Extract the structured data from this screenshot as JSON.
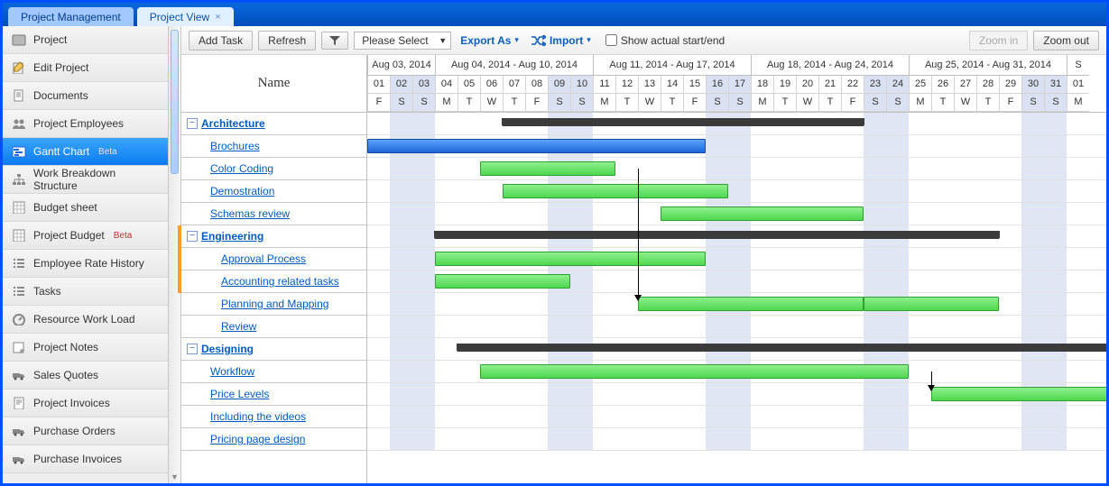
{
  "tabs": {
    "items": [
      "Project Management",
      "Project View"
    ],
    "active": 1
  },
  "sidebar": {
    "items": [
      {
        "label": "Project",
        "icon": "box"
      },
      {
        "label": "Edit Project",
        "icon": "edit"
      },
      {
        "label": "Documents",
        "icon": "doc"
      },
      {
        "label": "Project Employees",
        "icon": "people"
      },
      {
        "label": "Gantt Chart",
        "icon": "gantt",
        "beta": "Beta",
        "selected": true
      },
      {
        "label": "Work Breakdown Structure",
        "icon": "wbs"
      },
      {
        "label": "Budget sheet",
        "icon": "sheet"
      },
      {
        "label": "Project Budget",
        "icon": "sheet",
        "beta": "Beta"
      },
      {
        "label": "Employee Rate History",
        "icon": "list"
      },
      {
        "label": "Tasks",
        "icon": "list"
      },
      {
        "label": "Resource Work Load",
        "icon": "gauge"
      },
      {
        "label": "Project Notes",
        "icon": "note"
      },
      {
        "label": "Sales Quotes",
        "icon": "truck"
      },
      {
        "label": "Project Invoices",
        "icon": "invoice"
      },
      {
        "label": "Purchase Orders",
        "icon": "truck"
      },
      {
        "label": "Purchase Invoices",
        "icon": "truck"
      }
    ]
  },
  "toolbar": {
    "add_task": "Add Task",
    "refresh": "Refresh",
    "filter_icon": "filter-icon",
    "select_placeholder": "Please Select",
    "export": "Export As",
    "import": "Import",
    "actual": "Show actual start/end",
    "zoom_in": "Zoom in",
    "zoom_out": "Zoom out"
  },
  "grid": {
    "name_header": "Name"
  },
  "weeks": [
    {
      "label": "Aug 03, 2014",
      "days": 3
    },
    {
      "label": "Aug 04, 2014 - Aug 10, 2014",
      "days": 7
    },
    {
      "label": "Aug 11, 2014 - Aug 17, 2014",
      "days": 7
    },
    {
      "label": "Aug 18, 2014 - Aug 24, 2014",
      "days": 7
    },
    {
      "label": "Aug 25, 2014 - Aug 31, 2014",
      "days": 7
    },
    {
      "label": "S",
      "days": 1
    }
  ],
  "day_start": 1,
  "days": [
    "01",
    "02",
    "03",
    "04",
    "05",
    "06",
    "07",
    "08",
    "09",
    "10",
    "11",
    "12",
    "13",
    "14",
    "15",
    "16",
    "17",
    "18",
    "19",
    "20",
    "21",
    "22",
    "23",
    "24",
    "25",
    "26",
    "27",
    "28",
    "29",
    "30",
    "31",
    "01"
  ],
  "dow": [
    "F",
    "S",
    "S",
    "M",
    "T",
    "W",
    "T",
    "F",
    "S",
    "S",
    "M",
    "T",
    "W",
    "T",
    "F",
    "S",
    "S",
    "M",
    "T",
    "W",
    "T",
    "F",
    "S",
    "S",
    "M",
    "T",
    "W",
    "T",
    "F",
    "S",
    "S",
    "M"
  ],
  "weekend_idx": [
    1,
    2,
    8,
    9,
    15,
    16,
    22,
    23,
    29,
    30
  ],
  "rows": [
    {
      "name": "Architecture",
      "type": "group"
    },
    {
      "name": "Brochures",
      "type": "task",
      "indent": 1
    },
    {
      "name": "Color Coding",
      "type": "task",
      "indent": 1
    },
    {
      "name": "Demostration",
      "type": "task",
      "indent": 1
    },
    {
      "name": "Schemas review",
      "type": "task",
      "indent": 1
    },
    {
      "name": "Engineering",
      "type": "group"
    },
    {
      "name": "Approval Process",
      "type": "task",
      "indent": 2
    },
    {
      "name": "Accounting related tasks",
      "type": "task",
      "indent": 2
    },
    {
      "name": "Planning and Mapping",
      "type": "task",
      "indent": 2
    },
    {
      "name": "Review",
      "type": "task",
      "indent": 2
    },
    {
      "name": "Designing",
      "type": "group"
    },
    {
      "name": "Workflow",
      "type": "task",
      "indent": 1
    },
    {
      "name": "Price Levels",
      "type": "task",
      "indent": 1
    },
    {
      "name": "Including the videos",
      "type": "task",
      "indent": 1
    },
    {
      "name": "Pricing page design",
      "type": "task",
      "indent": 1
    }
  ],
  "chart_data": {
    "type": "gantt",
    "unit": "day",
    "origin": "2014-08-01",
    "bars": [
      {
        "row": 0,
        "kind": "summary",
        "start": 7,
        "span": 16
      },
      {
        "row": 1,
        "kind": "arch",
        "start": 1,
        "span": 15
      },
      {
        "row": 2,
        "kind": "task",
        "start": 6,
        "span": 6
      },
      {
        "row": 3,
        "kind": "task",
        "start": 7,
        "span": 10
      },
      {
        "row": 4,
        "kind": "task",
        "start": 14,
        "span": 9
      },
      {
        "row": 5,
        "kind": "summary",
        "start": 4,
        "span": 25
      },
      {
        "row": 6,
        "kind": "task",
        "start": 4,
        "span": 12
      },
      {
        "row": 7,
        "kind": "task",
        "start": 4,
        "span": 6
      },
      {
        "row": 8,
        "kind": "task",
        "start": 13,
        "span": 10
      },
      {
        "row": 8,
        "kind": "task",
        "start": 23,
        "span": 6
      },
      {
        "row": 10,
        "kind": "summary",
        "start": 5,
        "span": 29
      },
      {
        "row": 11,
        "kind": "task",
        "start": 6,
        "span": 19
      },
      {
        "row": 12,
        "kind": "task",
        "start": 26,
        "span": 8
      }
    ],
    "dependencies": [
      {
        "from": {
          "row": 2,
          "x": 12
        },
        "to": {
          "row": 8,
          "x": 13
        }
      },
      {
        "from": {
          "row": 11,
          "x": 25
        },
        "to": {
          "row": 12,
          "x": 26
        }
      }
    ]
  }
}
